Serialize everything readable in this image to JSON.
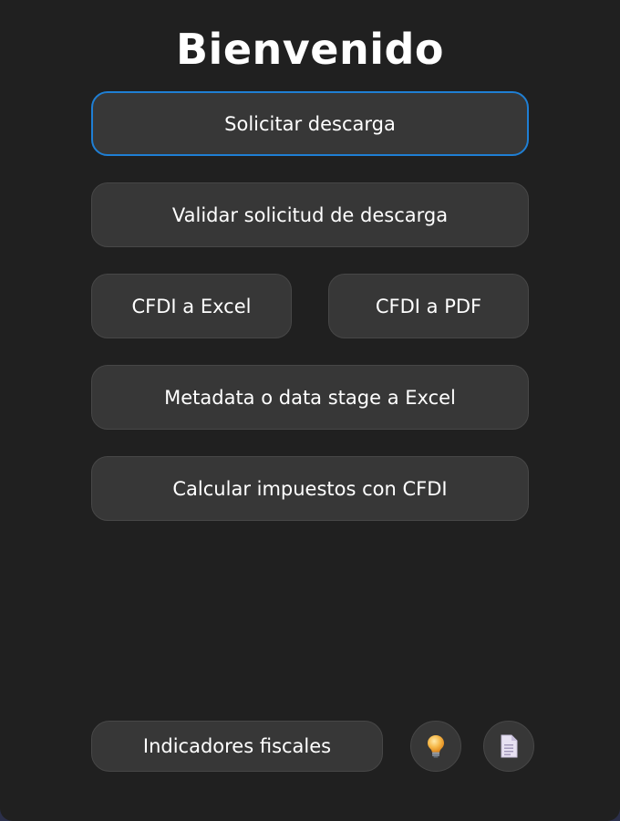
{
  "header": {
    "title": "Bienvenido"
  },
  "menu": {
    "solicitar_descarga": "Solicitar descarga",
    "validar_solicitud": "Validar solicitud de descarga",
    "cfdi_excel": "CFDI a Excel",
    "cfdi_pdf": "CFDI a PDF",
    "metadata_excel": "Metadata o data stage a Excel",
    "calcular_impuestos": "Calcular impuestos con CFDI"
  },
  "footer": {
    "indicadores": "Indicadores fiscales",
    "tips_icon": "lightbulb-icon",
    "doc_icon": "document-icon"
  },
  "colors": {
    "background": "#202020",
    "button": "#373737",
    "button_border": "#474747",
    "focus_accent": "#1f7fd4",
    "text": "#ffffff"
  }
}
